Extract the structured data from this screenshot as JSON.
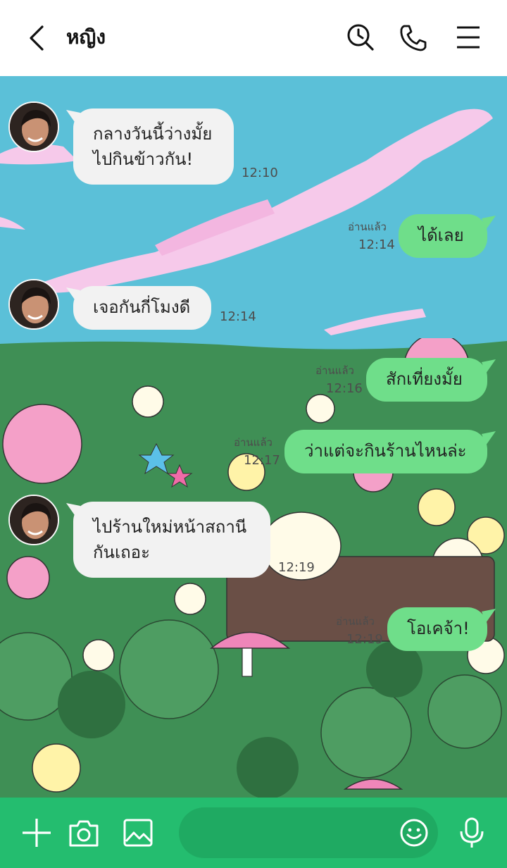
{
  "header": {
    "title": "หญิง"
  },
  "messages": [
    {
      "text": "กลางวันนี้ว่างมั้ย\nไปกินข้าวกัน!",
      "time": "12:10"
    },
    {
      "text": "ได้เลย",
      "time": "12:14",
      "read": "อ่านแล้ว"
    },
    {
      "text": "เจอกันกี่โมงดี",
      "time": "12:14"
    },
    {
      "text": "สักเที่ยงมั้ย",
      "time": "12:16",
      "read": "อ่านแล้ว"
    },
    {
      "text": "ว่าแต่จะกินร้านไหนล่ะ",
      "time": "12:17",
      "read": "อ่านแล้ว"
    },
    {
      "text": "ไปร้านใหม่หน้าสถานี\nกันเถอะ",
      "time": "12:19"
    },
    {
      "text": "โอเคจ้า!",
      "time": "12:19",
      "read": "อ่านแล้ว"
    }
  ],
  "colors": {
    "header": "#ffffff",
    "sky": "#5bc0d8",
    "meadow": "#3f8f55",
    "outgoing_bubble": "#6fde8a",
    "incoming_bubble": "#f2f2f2",
    "footer": "#24bd6f"
  }
}
